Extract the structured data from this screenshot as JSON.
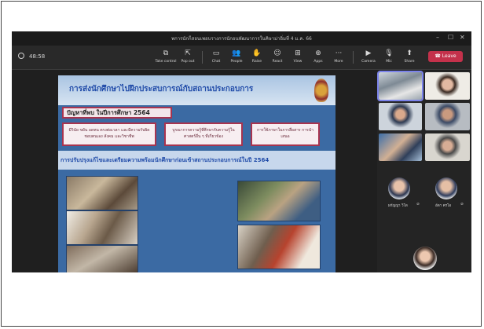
{
  "window": {
    "title": "พการนักก็สอนเพอบรางการนักอนพัฒนาการในคิษาม่าอิ่มที่ 4 ม.ค. 66",
    "minimize": "–",
    "maximize": "☐",
    "close": "✕"
  },
  "toolbar": {
    "timer": "48:58",
    "take_control": "Take control",
    "pop_out": "Pop out",
    "chat": "Chat",
    "people": "People",
    "raise": "Raise",
    "react": "React",
    "view": "View",
    "apps": "Apps",
    "more": "More",
    "camera": "Camera",
    "mic": "Mic",
    "share": "Share",
    "leave": "Leave"
  },
  "slide": {
    "title": "การส่งนักศึกษาไปฝึกประสบการณ์กับสถานประกอบการ",
    "problems_heading": "ปัญหาที่พบ ในปีการศึกษา 2564",
    "problem_1": "มีวินัย ขยัน อดทน ตรงต่อเวลา และมีความรับผิดชอบตนเอง สังคม และวิชาชีพ",
    "problem_2": "บูรณาการความรู้ที่ศึกษากับความรู้ในศาสตร์อื่น ๆ ที่เกี่ยวข้อง",
    "problem_3": "การใช้ภาษาในการสื่อสาร การนำเสนอ",
    "band": "การปรับปรุงแก้ไขและเตรียมความพร้อมนักศึกษาก่อนเข้าสถานประกอบการณ์ในปี 2564"
  },
  "participants": {
    "name_1": "ผกัญญา วิโด",
    "name_2": "อัดา ครโอ"
  },
  "colors": {
    "accent": "#7b83eb",
    "leave": "#c4314b",
    "slide_blue": "#3b6aa3",
    "box_border": "#a8344f"
  }
}
